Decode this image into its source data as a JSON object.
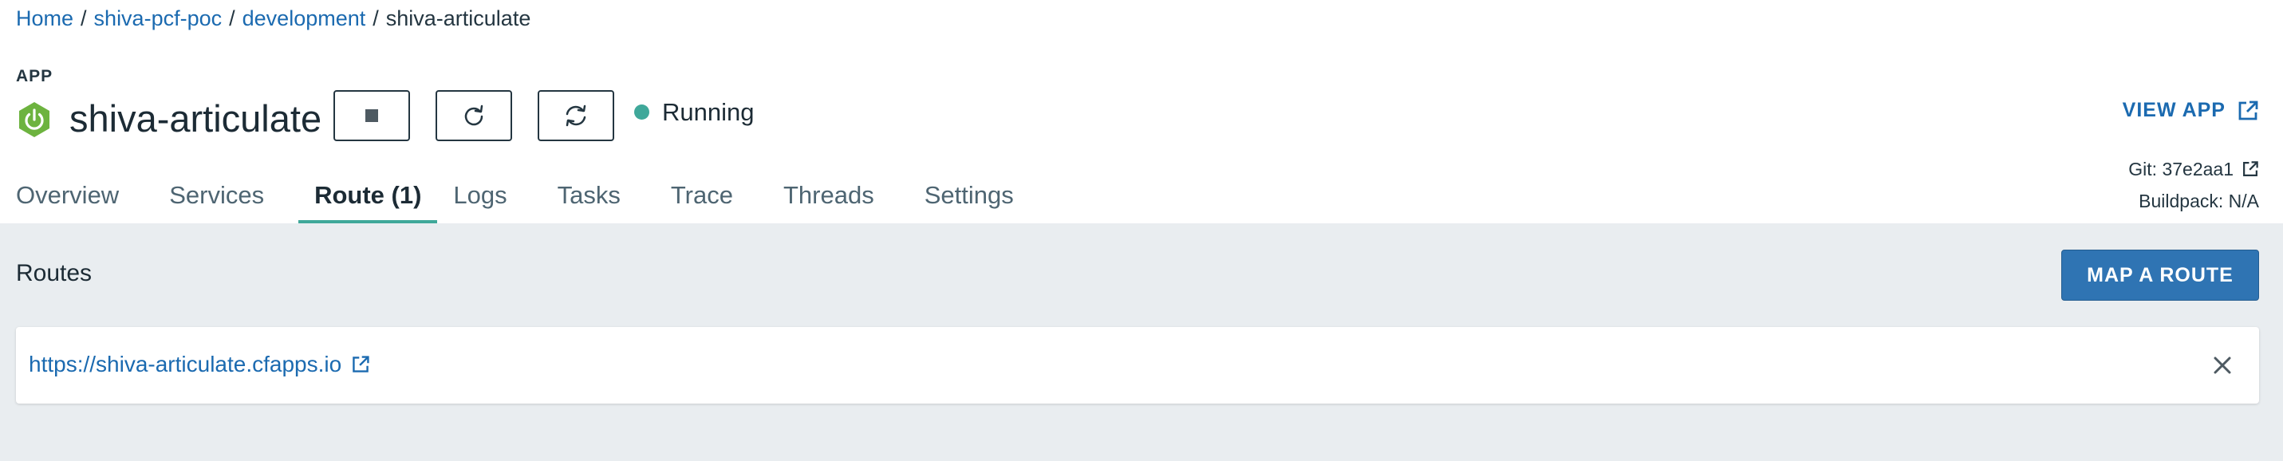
{
  "breadcrumb": {
    "items": [
      "Home",
      "shiva-pcf-poc",
      "development"
    ],
    "current": "shiva-articulate",
    "separator": "/"
  },
  "app": {
    "type_label": "APP",
    "name": "shiva-articulate",
    "icon": "power-icon",
    "status": "Running",
    "status_color": "#3fa89a",
    "controls": [
      "stop-icon",
      "restart-icon",
      "restage-icon"
    ]
  },
  "header_right": {
    "view_app_label": "VIEW APP",
    "git_label": "Git: 37e2aa1",
    "buildpack_label": "Buildpack: N/A"
  },
  "tabs": [
    {
      "label": "Overview",
      "active": false
    },
    {
      "label": "Services",
      "active": false
    },
    {
      "label": "Route (1)",
      "active": true
    },
    {
      "label": "Logs",
      "active": false
    },
    {
      "label": "Tasks",
      "active": false
    },
    {
      "label": "Trace",
      "active": false
    },
    {
      "label": "Threads",
      "active": false
    },
    {
      "label": "Settings",
      "active": false
    }
  ],
  "routes": {
    "title": "Routes",
    "map_button_label": "MAP A ROUTE",
    "items": [
      {
        "url": "https://shiva-articulate.cfapps.io"
      }
    ]
  },
  "colors": {
    "accent": "#3fa89a",
    "link": "#1b6ab0",
    "primary_button": "#2f74b3",
    "app_icon": "#6db33f",
    "content_bg": "#e9edf0"
  }
}
